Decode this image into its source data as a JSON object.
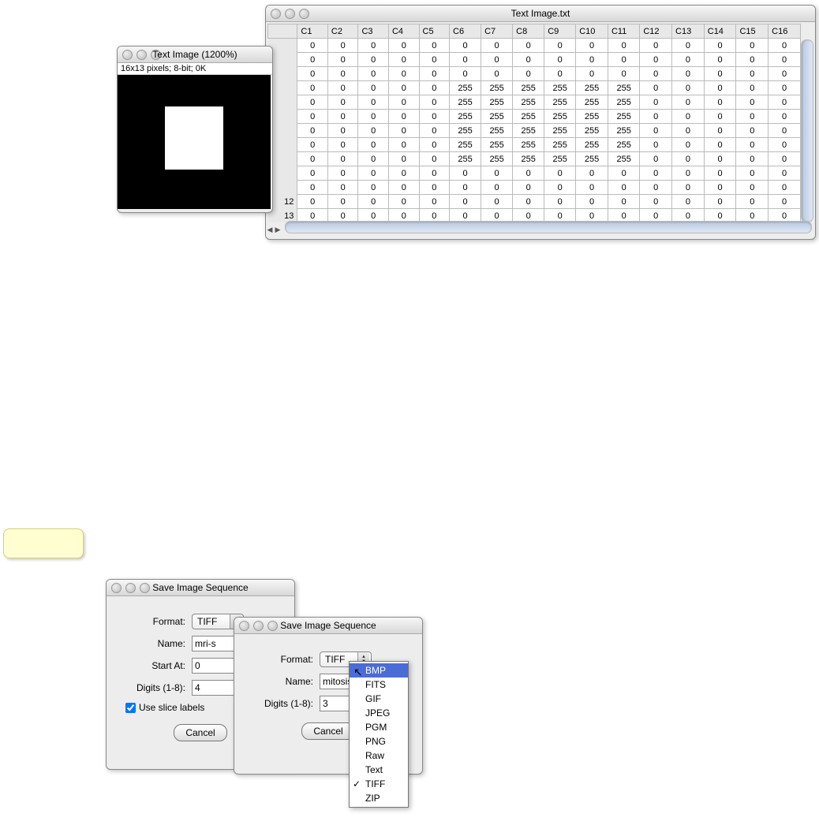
{
  "imageWindow": {
    "title": "Text Image (1200%)",
    "meta": "16x13 pixels; 8-bit; 0K"
  },
  "dataWindow": {
    "title": "Text Image.txt",
    "columns": [
      "C1",
      "C2",
      "C3",
      "C4",
      "C5",
      "C6",
      "C7",
      "C8",
      "C9",
      "C10",
      "C11",
      "C12",
      "C13",
      "C14",
      "C15",
      "C16"
    ],
    "rowLabels": [
      "",
      "",
      "",
      "",
      "",
      "",
      "",
      "",
      "",
      "",
      "",
      "12",
      "13"
    ],
    "rows": [
      [
        0,
        0,
        0,
        0,
        0,
        0,
        0,
        0,
        0,
        0,
        0,
        0,
        0,
        0,
        0,
        0
      ],
      [
        0,
        0,
        0,
        0,
        0,
        0,
        0,
        0,
        0,
        0,
        0,
        0,
        0,
        0,
        0,
        0
      ],
      [
        0,
        0,
        0,
        0,
        0,
        0,
        0,
        0,
        0,
        0,
        0,
        0,
        0,
        0,
        0,
        0
      ],
      [
        0,
        0,
        0,
        0,
        0,
        255,
        255,
        255,
        255,
        255,
        255,
        0,
        0,
        0,
        0,
        0
      ],
      [
        0,
        0,
        0,
        0,
        0,
        255,
        255,
        255,
        255,
        255,
        255,
        0,
        0,
        0,
        0,
        0
      ],
      [
        0,
        0,
        0,
        0,
        0,
        255,
        255,
        255,
        255,
        255,
        255,
        0,
        0,
        0,
        0,
        0
      ],
      [
        0,
        0,
        0,
        0,
        0,
        255,
        255,
        255,
        255,
        255,
        255,
        0,
        0,
        0,
        0,
        0
      ],
      [
        0,
        0,
        0,
        0,
        0,
        255,
        255,
        255,
        255,
        255,
        255,
        0,
        0,
        0,
        0,
        0
      ],
      [
        0,
        0,
        0,
        0,
        0,
        255,
        255,
        255,
        255,
        255,
        255,
        0,
        0,
        0,
        0,
        0
      ],
      [
        0,
        0,
        0,
        0,
        0,
        0,
        0,
        0,
        0,
        0,
        0,
        0,
        0,
        0,
        0,
        0
      ],
      [
        0,
        0,
        0,
        0,
        0,
        0,
        0,
        0,
        0,
        0,
        0,
        0,
        0,
        0,
        0,
        0
      ],
      [
        0,
        0,
        0,
        0,
        0,
        0,
        0,
        0,
        0,
        0,
        0,
        0,
        0,
        0,
        0,
        0
      ],
      [
        0,
        0,
        0,
        0,
        0,
        0,
        0,
        0,
        0,
        0,
        0,
        0,
        0,
        0,
        0,
        0
      ]
    ]
  },
  "dlg1": {
    "title": "Save Image Sequence",
    "formatLabel": "Format:",
    "formatValue": "TIFF",
    "nameLabel": "Name:",
    "nameValue": "mri-s",
    "startLabel": "Start At:",
    "startValue": "0",
    "digitsLabel": "Digits (1-8):",
    "digitsValue": "4",
    "sliceLabel": "Use slice labels",
    "cancel": "Cancel"
  },
  "dlg2": {
    "title": "Save Image Sequence",
    "formatLabel": "Format:",
    "formatValue": "TIFF",
    "nameLabel": "Name:",
    "nameValue": "mitosis",
    "digitsLabel": "Digits (1-8):",
    "digitsValue": "3",
    "cancel": "Cancel"
  },
  "dropdown": {
    "items": [
      "BMP",
      "FITS",
      "GIF",
      "JPEG",
      "PGM",
      "PNG",
      "Raw",
      "Text",
      "TIFF",
      "ZIP"
    ],
    "highlighted": "BMP",
    "checked": "TIFF"
  }
}
